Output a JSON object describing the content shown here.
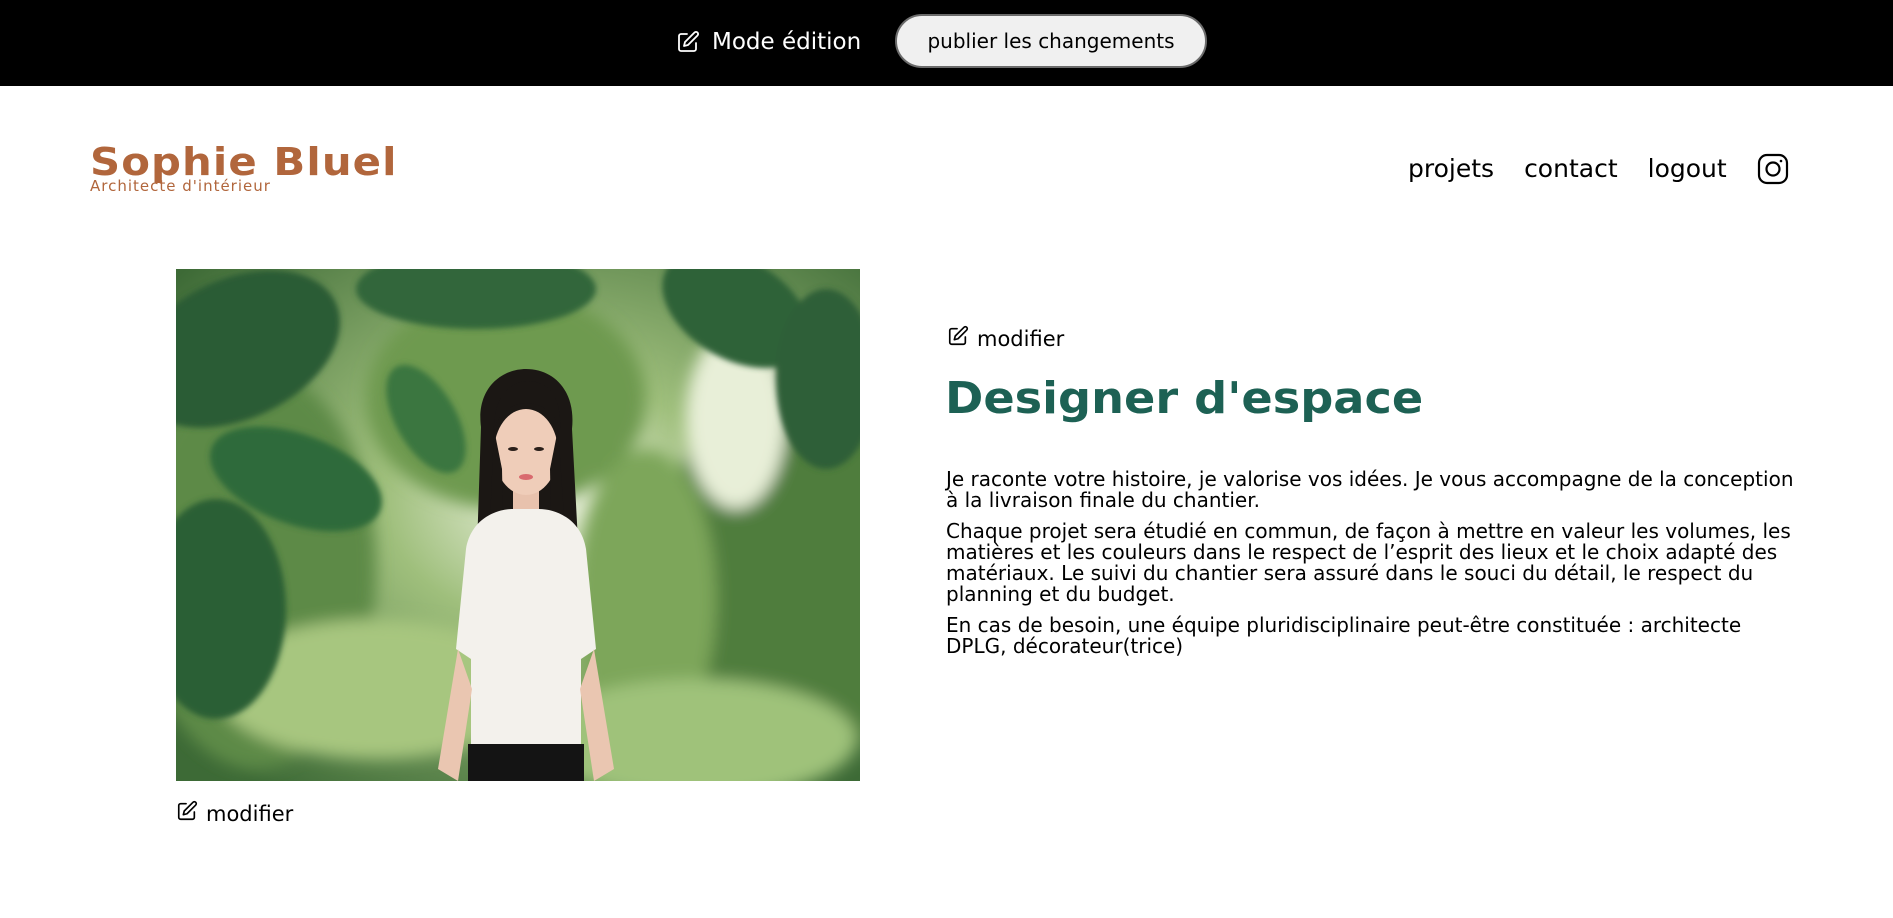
{
  "edit_bar": {
    "mode_label": "Mode édition",
    "publish_label": "publier les changements"
  },
  "header": {
    "logo_title": "Sophie Bluel",
    "logo_subtitle": "Architecte d'intérieur",
    "nav": {
      "projets": "projets",
      "contact": "contact",
      "logout": "logout"
    }
  },
  "introduction": {
    "photo_modify_label": "modifier",
    "text_modify_label": "modifier",
    "title": "Designer d'espace",
    "paragraphs": [
      "Je raconte votre histoire, je valorise vos idées. Je vous accompagne de la conception à la livraison finale du chantier.",
      "Chaque projet sera étudié en commun, de façon à mettre en valeur les volumes, les matières et les couleurs dans le respect de l’esprit des lieux et le choix adapté des matériaux. Le suivi du chantier sera assuré dans le souci du détail, le respect du planning et du budget.",
      "En cas de besoin, une équipe pluridisciplinaire peut-être constituée : architecte DPLG, décorateur(trice)"
    ]
  },
  "colors": {
    "brand": "#B1663C",
    "title": "#1D6154",
    "edit_bar_bg": "#000000"
  },
  "icons": {
    "edit": "pen-to-square-icon",
    "social": "instagram-icon"
  }
}
